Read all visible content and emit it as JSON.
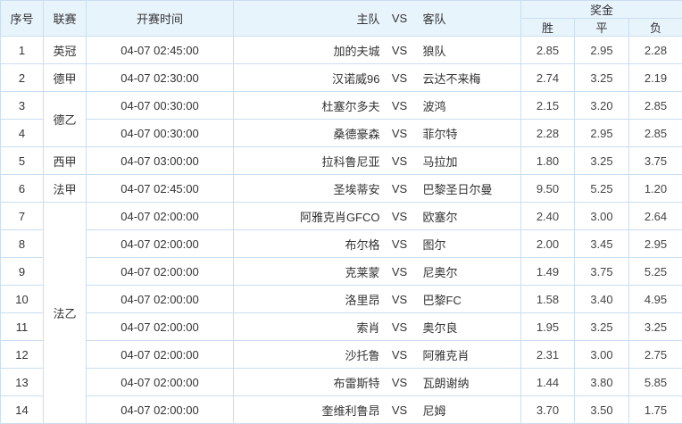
{
  "headers": {
    "index": "序号",
    "league": "联赛",
    "time": "开赛时间",
    "home": "主队",
    "vs": "VS",
    "away": "客队",
    "prize": "奖金",
    "win": "胜",
    "draw": "平",
    "lose": "负"
  },
  "vs_label": "VS",
  "rows": [
    {
      "index": "1",
      "league": "英冠",
      "league_span": 1,
      "time": "04-07 02:45:00",
      "home": "加的夫城",
      "away": "狼队",
      "win": "2.85",
      "draw": "2.95",
      "lose": "2.28"
    },
    {
      "index": "2",
      "league": "德甲",
      "league_span": 1,
      "time": "04-07 02:30:00",
      "home": "汉诺威96",
      "away": "云达不来梅",
      "win": "2.74",
      "draw": "3.25",
      "lose": "2.19"
    },
    {
      "index": "3",
      "league": "德乙",
      "league_span": 2,
      "time": "04-07 00:30:00",
      "home": "杜塞尔多夫",
      "away": "波鸿",
      "win": "2.15",
      "draw": "3.20",
      "lose": "2.85"
    },
    {
      "index": "4",
      "time": "04-07 00:30:00",
      "home": "桑德豪森",
      "away": "菲尔特",
      "win": "2.28",
      "draw": "2.95",
      "lose": "2.85"
    },
    {
      "index": "5",
      "league": "西甲",
      "league_span": 1,
      "time": "04-07 03:00:00",
      "home": "拉科鲁尼亚",
      "away": "马拉加",
      "win": "1.80",
      "draw": "3.25",
      "lose": "3.75"
    },
    {
      "index": "6",
      "league": "法甲",
      "league_span": 1,
      "time": "04-07 02:45:00",
      "home": "圣埃蒂安",
      "away": "巴黎圣日尔曼",
      "win": "9.50",
      "draw": "5.25",
      "lose": "1.20"
    },
    {
      "index": "7",
      "league": "法乙",
      "league_span": 8,
      "time": "04-07 02:00:00",
      "home": "阿雅克肖GFCO",
      "away": "欧塞尔",
      "win": "2.40",
      "draw": "3.00",
      "lose": "2.64"
    },
    {
      "index": "8",
      "time": "04-07 02:00:00",
      "home": "布尔格",
      "away": "图尔",
      "win": "2.00",
      "draw": "3.45",
      "lose": "2.95"
    },
    {
      "index": "9",
      "time": "04-07 02:00:00",
      "home": "克莱蒙",
      "away": "尼奥尔",
      "win": "1.49",
      "draw": "3.75",
      "lose": "5.25"
    },
    {
      "index": "10",
      "time": "04-07 02:00:00",
      "home": "洛里昂",
      "away": "巴黎FC",
      "win": "1.58",
      "draw": "3.40",
      "lose": "4.95"
    },
    {
      "index": "11",
      "time": "04-07 02:00:00",
      "home": "索肖",
      "away": "奥尔良",
      "win": "1.95",
      "draw": "3.25",
      "lose": "3.25"
    },
    {
      "index": "12",
      "time": "04-07 02:00:00",
      "home": "沙托鲁",
      "away": "阿雅克肖",
      "win": "2.31",
      "draw": "3.00",
      "lose": "2.75"
    },
    {
      "index": "13",
      "time": "04-07 02:00:00",
      "home": "布雷斯特",
      "away": "瓦朗谢纳",
      "win": "1.44",
      "draw": "3.80",
      "lose": "5.85"
    },
    {
      "index": "14",
      "time": "04-07 02:00:00",
      "home": "奎维利鲁昂",
      "away": "尼姆",
      "win": "3.70",
      "draw": "3.50",
      "lose": "1.75"
    }
  ]
}
